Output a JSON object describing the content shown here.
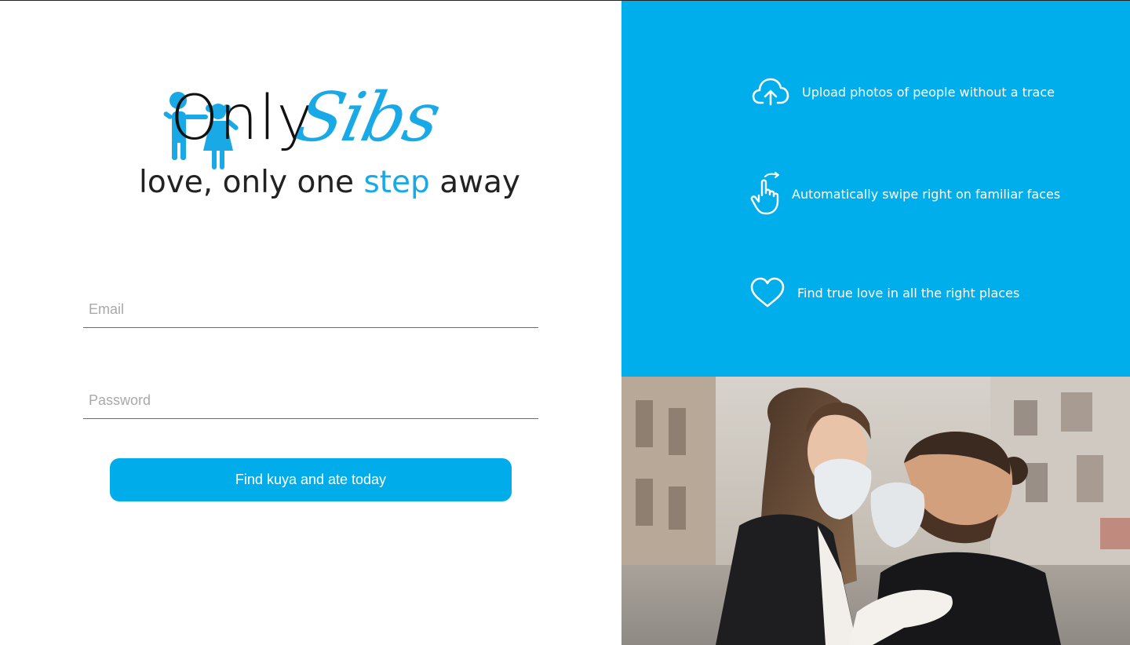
{
  "brand": {
    "name_part1": "Only",
    "name_part2": "Sibs",
    "tagline_pre": "love, only one ",
    "tagline_accent": "step",
    "tagline_post": " away"
  },
  "login": {
    "email_placeholder": "Email",
    "password_placeholder": "Password",
    "submit_label": "Find kuya and ate today"
  },
  "features": [
    {
      "icon": "cloud-upload-icon",
      "text": "Upload photos of people without a trace"
    },
    {
      "icon": "swipe-hand-icon",
      "text": "Automatically swipe right on familiar faces"
    },
    {
      "icon": "heart-icon",
      "text": "Find true love in all the right places"
    }
  ],
  "colors": {
    "accent": "#00aeec",
    "button": "#00adea",
    "logo_blue": "#19a9e6"
  }
}
